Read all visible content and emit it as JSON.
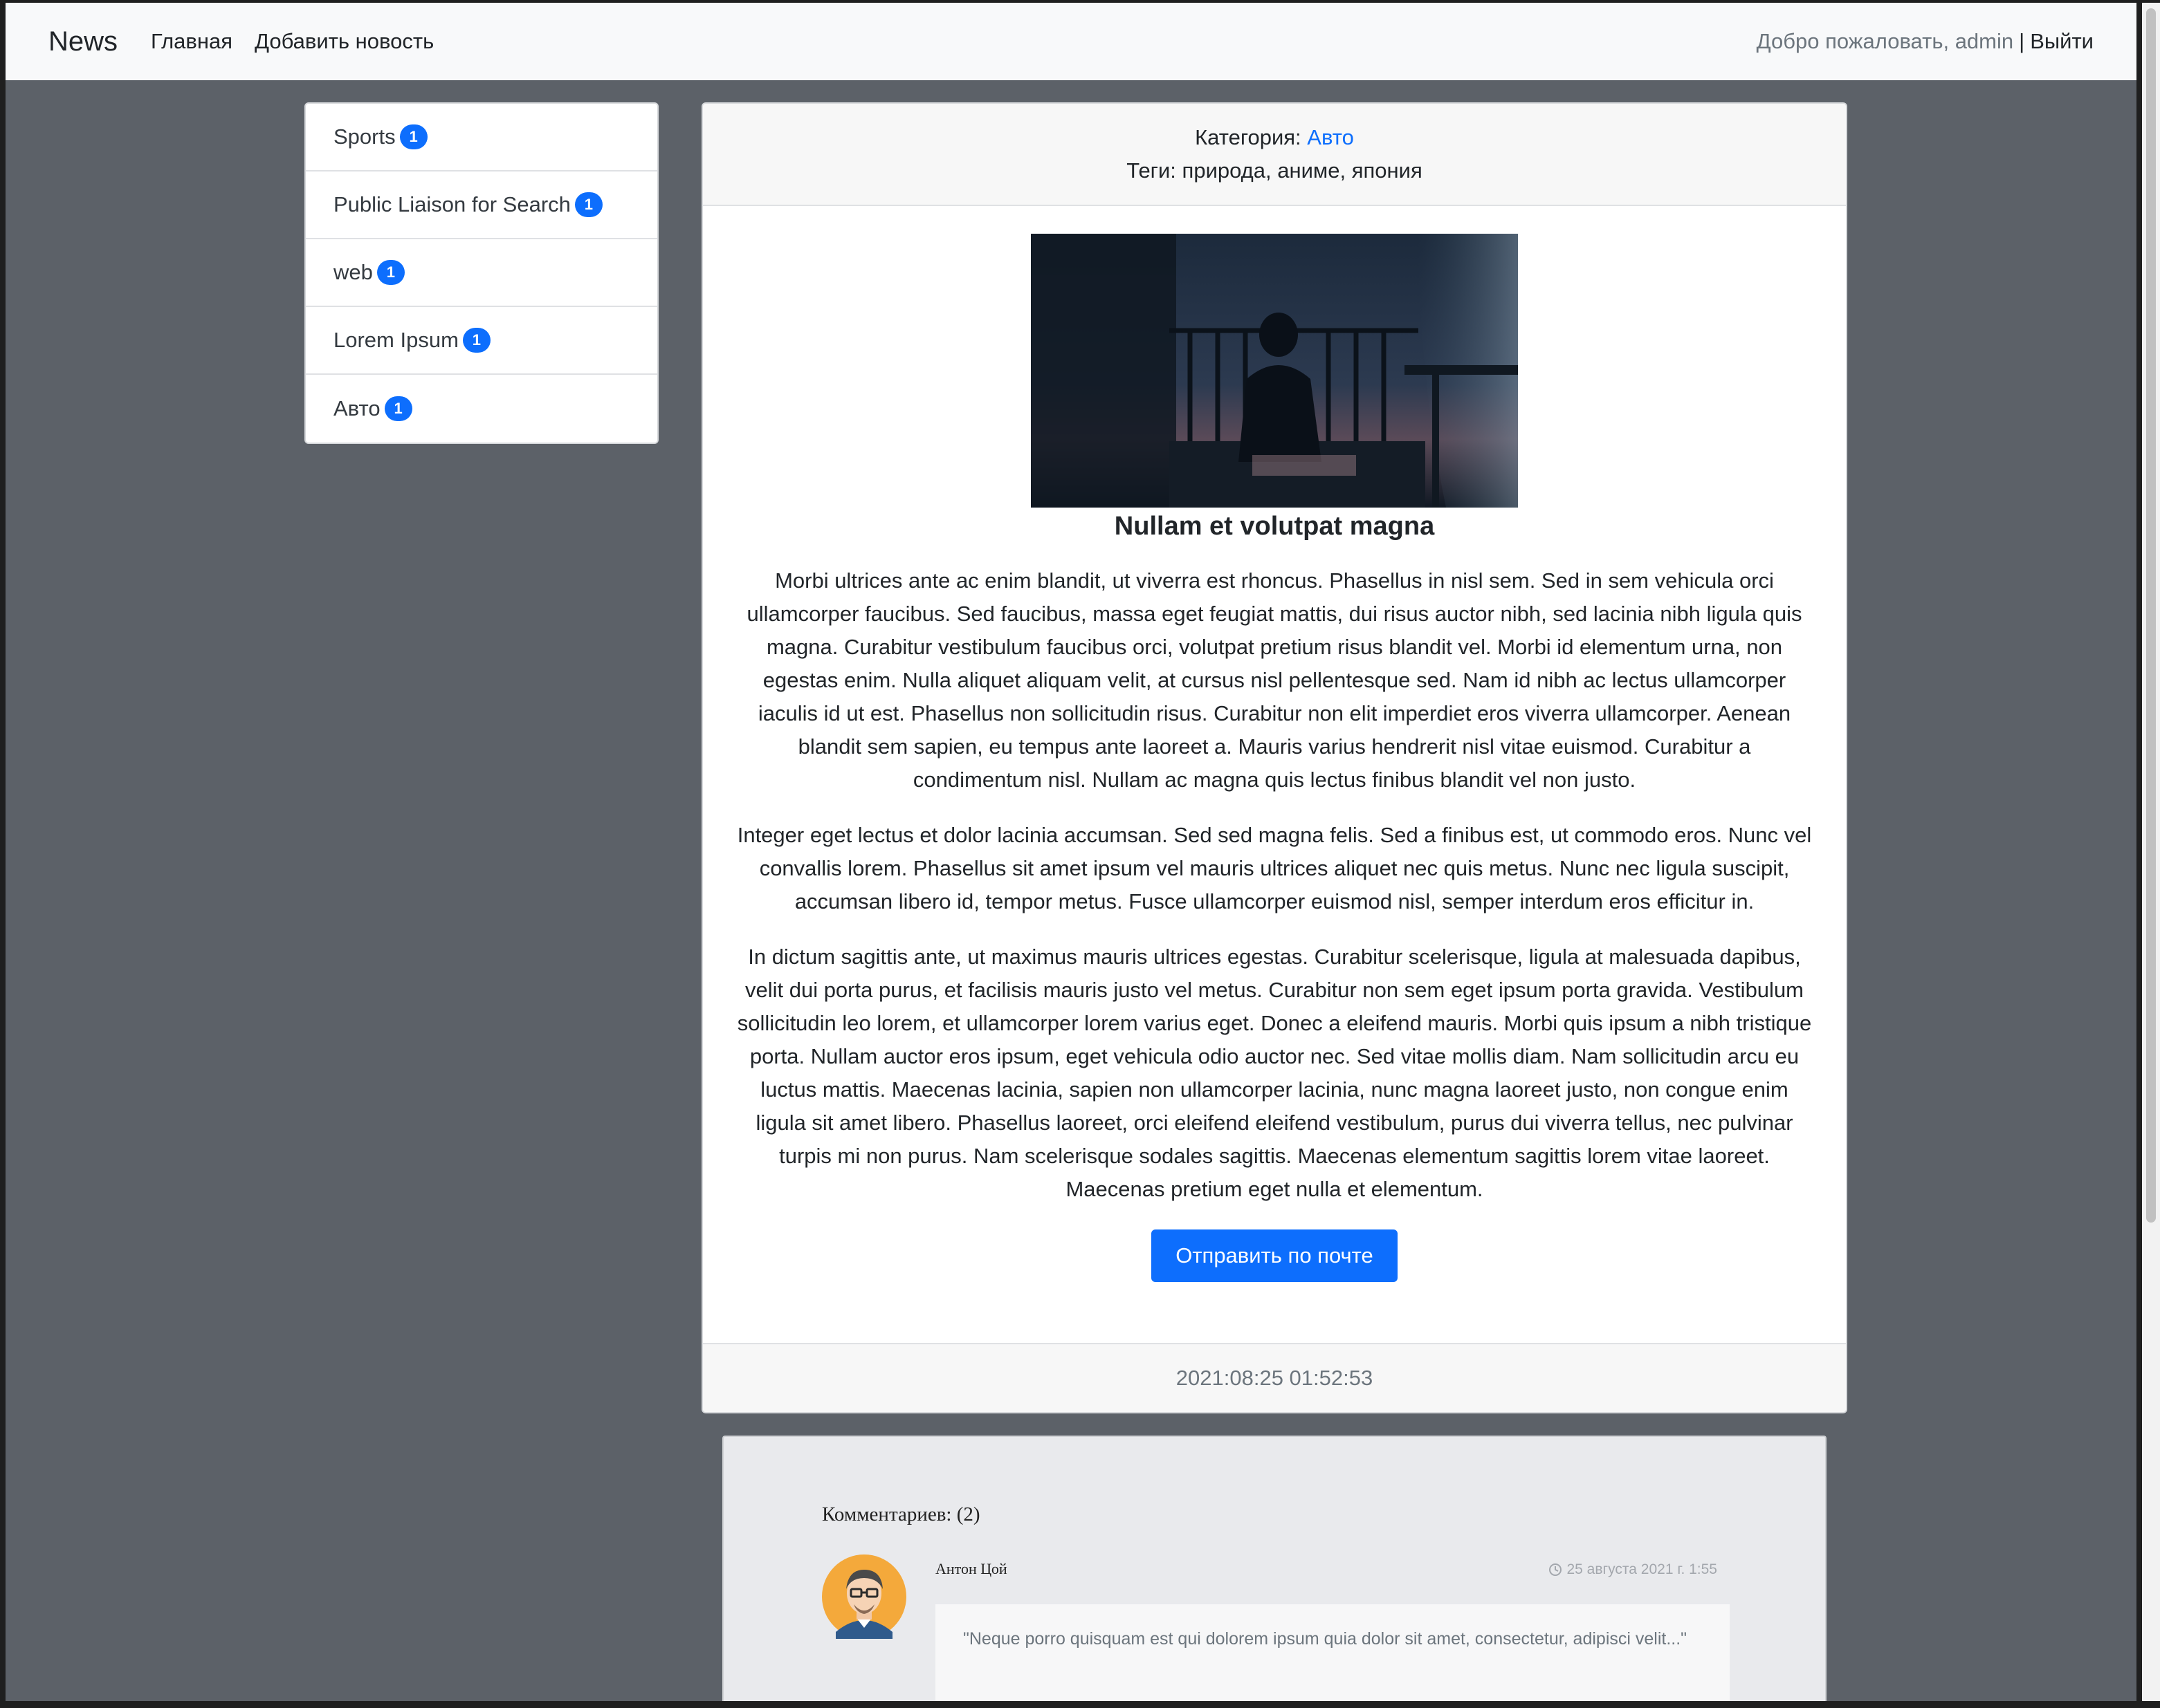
{
  "navbar": {
    "brand": "News",
    "links": [
      "Главная",
      "Добавить новость"
    ],
    "welcome": "Добро пожаловать, admin",
    "separator": "|",
    "logout": "Выйти"
  },
  "categories": [
    {
      "name": "Sports",
      "count": "1"
    },
    {
      "name": "Public Liaison for Search",
      "count": "1"
    },
    {
      "name": "web",
      "count": "1"
    },
    {
      "name": "Lorem Ipsum",
      "count": "1"
    },
    {
      "name": "Авто",
      "count": "1"
    }
  ],
  "post": {
    "category_label": "Категория:",
    "category": "Авто",
    "tags_text": "Теги: природа, аниме, япония",
    "title": "Nullam et volutpat magna",
    "paragraphs": [
      "Morbi ultrices ante ac enim blandit, ut viverra est rhoncus. Phasellus in nisl sem. Sed in sem vehicula orci ullamcorper faucibus. Sed faucibus, massa eget feugiat mattis, dui risus auctor nibh, sed lacinia nibh ligula quis magna. Curabitur vestibulum faucibus orci, volutpat pretium risus blandit vel. Morbi id elementum urna, non egestas enim. Nulla aliquet aliquam velit, at cursus nisl pellentesque sed. Nam id nibh ac lectus ullamcorper iaculis id ut est. Phasellus non sollicitudin risus. Curabitur non elit imperdiet eros viverra ullamcorper. Aenean blandit sem sapien, eu tempus ante laoreet a. Mauris varius hendrerit nisl vitae euismod. Curabitur a condimentum nisl. Nullam ac magna quis lectus finibus blandit vel non justo.",
      "Integer eget lectus et dolor lacinia accumsan. Sed sed magna felis. Sed a finibus est, ut commodo eros. Nunc vel convallis lorem. Phasellus sit amet ipsum vel mauris ultrices aliquet nec quis metus. Nunc nec ligula suscipit, accumsan libero id, tempor metus. Fusce ullamcorper euismod nisl, semper interdum eros efficitur in.",
      "In dictum sagittis ante, ut maximus mauris ultrices egestas. Curabitur scelerisque, ligula at malesuada dapibus, velit dui porta purus, et facilisis mauris justo vel metus. Curabitur non sem eget ipsum porta gravida. Vestibulum sollicitudin leo lorem, et ullamcorper lorem varius eget. Donec a eleifend mauris. Morbi quis ipsum a nibh tristique porta. Nullam auctor eros ipsum, eget vehicula odio auctor nec. Sed vitae mollis diam. Nam sollicitudin arcu eu luctus mattis. Maecenas lacinia, sapien non ullamcorper lacinia, nunc magna laoreet justo, non congue enim ligula sit amet libero. Phasellus laoreet, orci eleifend eleifend vestibulum, purus dui viverra tellus, nec pulvinar turpis mi non purus. Nam scelerisque sodales sagittis. Maecenas elementum sagittis lorem vitae laoreet. Maecenas pretium eget nulla et elementum."
    ],
    "send_button": "Отправить по почте",
    "timestamp": "2021:08:25 01:52:53"
  },
  "comments": {
    "count_text": "Комментариев: (2)",
    "items": [
      {
        "author": "Антон Цой",
        "date": "25 августа 2021 г. 1:55",
        "text": "\"Neque porro quisquam est qui dolorem ipsum quia dolor sit amet, consectetur, adipisci velit...\""
      }
    ]
  },
  "colors": {
    "accent": "#0d6efd",
    "page_background": "#5c6168",
    "navbar_background": "#f8f9fa"
  },
  "icons": {
    "clock": "clock-icon",
    "avatar": "user-avatar"
  }
}
